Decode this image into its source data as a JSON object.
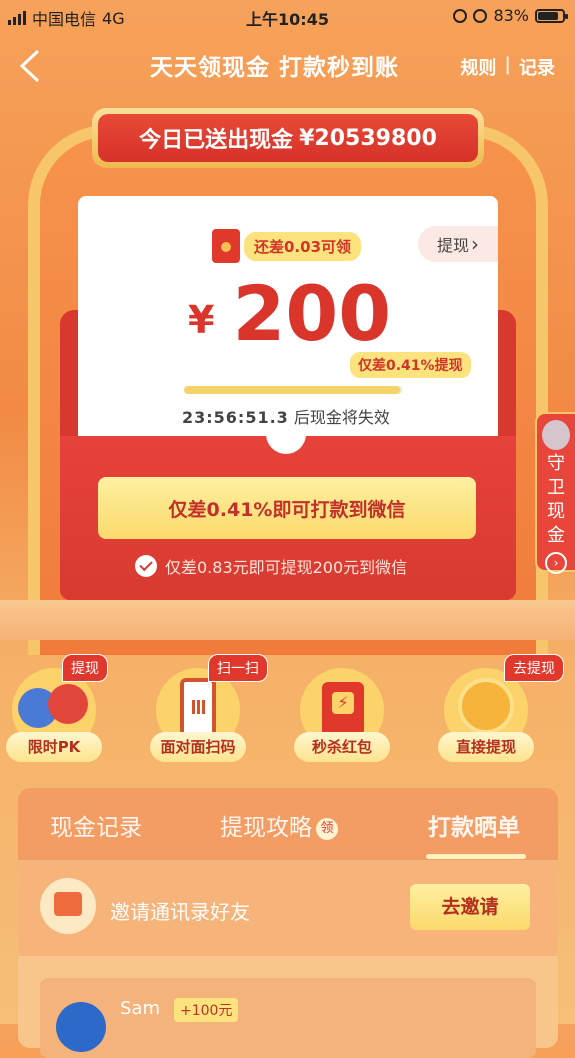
{
  "status_bar": {
    "carrier": "中国电信",
    "network": "4G",
    "time": "上午10:45",
    "battery": "83%",
    "battery_level": 0.83
  },
  "header": {
    "title": "天天领现金 打款秒到账",
    "rules_link": "规则",
    "separator": "|",
    "records_link": "记录"
  },
  "banner": {
    "label": "今日已送出现金",
    "amount": "¥20539800"
  },
  "card": {
    "tag": "还差0.03可领",
    "withdraw_label": "提现",
    "withdraw_chevron": "›",
    "currency": "¥",
    "amount": "200",
    "percent_bubble": "仅差0.41%提现",
    "progress": 0.99,
    "countdown_time": "23:56:51.3",
    "countdown_suffix": "后现金将失效"
  },
  "cta": {
    "label": "仅差0.41%即可打款到微信"
  },
  "wechat_line": "仅差0.83元即可提现200元到微信",
  "side_tab": {
    "label": "守卫现金",
    "chevron": "›"
  },
  "actions": [
    {
      "label": "限时PK",
      "badge": "提现",
      "icon": "boxing-gloves-icon"
    },
    {
      "label": "面对面扫码",
      "badge": "扫一扫",
      "icon": "qr-phone-icon"
    },
    {
      "label": "秒杀红包",
      "badge": "",
      "icon": "lightning-redpacket-icon"
    },
    {
      "label": "直接提现",
      "badge": "去提现",
      "icon": "wechat-coin-icon"
    }
  ],
  "tabs": [
    {
      "label": "现金记录"
    },
    {
      "label": "提现攻略",
      "badge": "领"
    },
    {
      "label": "打款晒单"
    }
  ],
  "invite": {
    "text": "邀请通讯录好友",
    "button": "去邀请"
  },
  "record": {
    "name": "Sam",
    "amount": "+100元"
  },
  "colors": {
    "accent_red": "#d9352a",
    "gold": "#fbd96c"
  }
}
